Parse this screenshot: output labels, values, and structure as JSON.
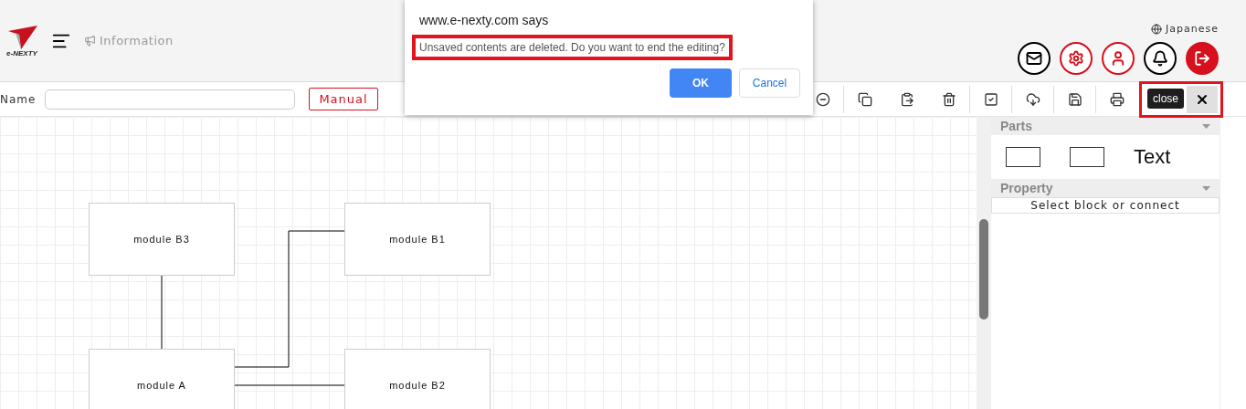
{
  "header": {
    "logo_text": "e-NEXTY",
    "information": "Information",
    "language": "Japanese",
    "buttons": [
      {
        "kind": "mail"
      },
      {
        "kind": "settings"
      },
      {
        "kind": "user"
      },
      {
        "kind": "bell"
      },
      {
        "kind": "logout"
      }
    ]
  },
  "toolbar": {
    "name_label": "Name",
    "manual_button": "Manual",
    "tools": [
      {
        "kind": "zoom-out"
      },
      {
        "kind": "copy"
      },
      {
        "kind": "paste"
      },
      {
        "kind": "delete"
      },
      {
        "kind": "check"
      },
      {
        "kind": "download"
      },
      {
        "kind": "save"
      },
      {
        "kind": "print"
      }
    ],
    "close_tooltip": "close",
    "close_highlighted": true
  },
  "diagram": {
    "nodes": [
      {
        "label": "module B3"
      },
      {
        "label": "module B1"
      },
      {
        "label": "module A"
      },
      {
        "label": "module B2"
      }
    ]
  },
  "side_panel": {
    "parts": {
      "title": "Parts",
      "items": [
        {
          "kind": "block"
        },
        {
          "kind": "block"
        },
        {
          "kind": "text",
          "label": "Text"
        }
      ]
    },
    "property": {
      "title": "Property",
      "message": "Select block or connect"
    }
  },
  "dialog": {
    "origin": "www.e-nexty.com says",
    "message": "Unsaved contents are deleted. Do you want to end the editing?",
    "message_highlighted": true,
    "ok": "OK",
    "cancel": "Cancel"
  }
}
